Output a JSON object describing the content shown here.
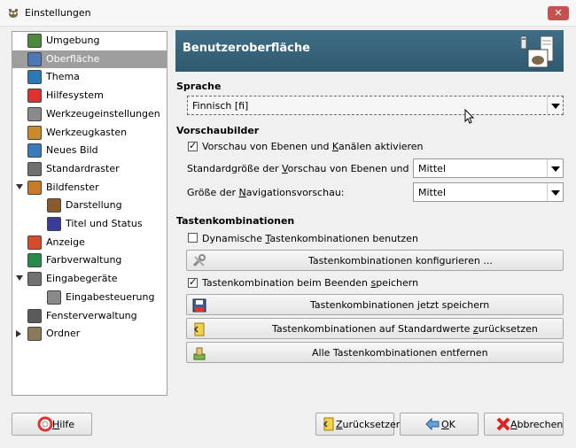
{
  "window": {
    "title": "Einstellungen",
    "close_glyph": "✕"
  },
  "sidebar": {
    "items": [
      {
        "label": "Umgebung",
        "icon": "environment-icon"
      },
      {
        "label": "Oberfläche",
        "icon": "interface-icon",
        "selected": true
      },
      {
        "label": "Thema",
        "icon": "theme-icon"
      },
      {
        "label": "Hilfesystem",
        "icon": "lifebuoy-icon"
      },
      {
        "label": "Werkzeugeinstellungen",
        "icon": "tool-options-icon"
      },
      {
        "label": "Werkzeugkasten",
        "icon": "toolbox-icon"
      },
      {
        "label": "Neues Bild",
        "icon": "new-image-icon"
      },
      {
        "label": "Standardraster",
        "icon": "grid-icon"
      },
      {
        "label": "Bildfenster",
        "icon": "image-window-icon",
        "expanded": true
      },
      {
        "label": "Darstellung",
        "icon": "appearance-icon"
      },
      {
        "label": "Titel und Status",
        "icon": "title-status-icon"
      },
      {
        "label": "Anzeige",
        "icon": "display-icon"
      },
      {
        "label": "Farbverwaltung",
        "icon": "color-management-icon"
      },
      {
        "label": "Eingabegeräte",
        "icon": "input-devices-icon",
        "expanded": true
      },
      {
        "label": "Eingabesteuerung",
        "icon": "input-controllers-icon"
      },
      {
        "label": "Fensterverwaltung",
        "icon": "window-management-icon"
      },
      {
        "label": "Ordner",
        "icon": "folder-icon",
        "expanded": false
      }
    ]
  },
  "header": {
    "title": "Benutzeroberfläche"
  },
  "language": {
    "section": "Sprache",
    "value": "Finnisch [fi]"
  },
  "previews": {
    "section": "Vorschaubilder",
    "enable_label_pre": "Vorschau von Ebenen und ",
    "enable_label_u": "K",
    "enable_label_post": "anälen aktivieren",
    "enable_checked": true,
    "layer_size_label_pre": "Standardgröße der ",
    "layer_size_label_u": "V",
    "layer_size_label_post": "orschau von Ebenen und Kanälen:",
    "layer_size_value": "Mittel",
    "nav_size_label_pre": "Größe der ",
    "nav_size_label_u": "N",
    "nav_size_label_post": "avigationsvorschau:",
    "nav_size_value": "Mittel"
  },
  "shortcuts": {
    "section": "Tastenkombinationen",
    "dynamic_pre": "Dynamische ",
    "dynamic_u": "T",
    "dynamic_post": "astenkombinationen benutzen",
    "dynamic_checked": false,
    "configure_label": "Tastenkombinationen konfigurieren ...",
    "save_on_exit_pre": "Tastenkombination beim Beenden ",
    "save_on_exit_u": "s",
    "save_on_exit_post": "peichern",
    "save_on_exit_checked": true,
    "save_now_pre": "Tastenkombinationen ",
    "save_now_u": "j",
    "save_now_post": "etzt speichern",
    "reset_pre": "Tastenkombinationen auf Standardwerte ",
    "reset_u": "z",
    "reset_post": "urücksetzen",
    "remove_label": "Alle Tastenkombinationen entfernen"
  },
  "footer": {
    "help_u": "H",
    "help_post": "ilfe",
    "reset_u": "Z",
    "reset_post": "urücksetzen",
    "ok_u": "O",
    "ok_post": "K",
    "cancel_u": "A",
    "cancel_post": "bbrechen"
  },
  "colors": {
    "header_bg": "#3f6e86",
    "selected_bg": "#9e9e9e",
    "close_bg": "#c75050"
  }
}
